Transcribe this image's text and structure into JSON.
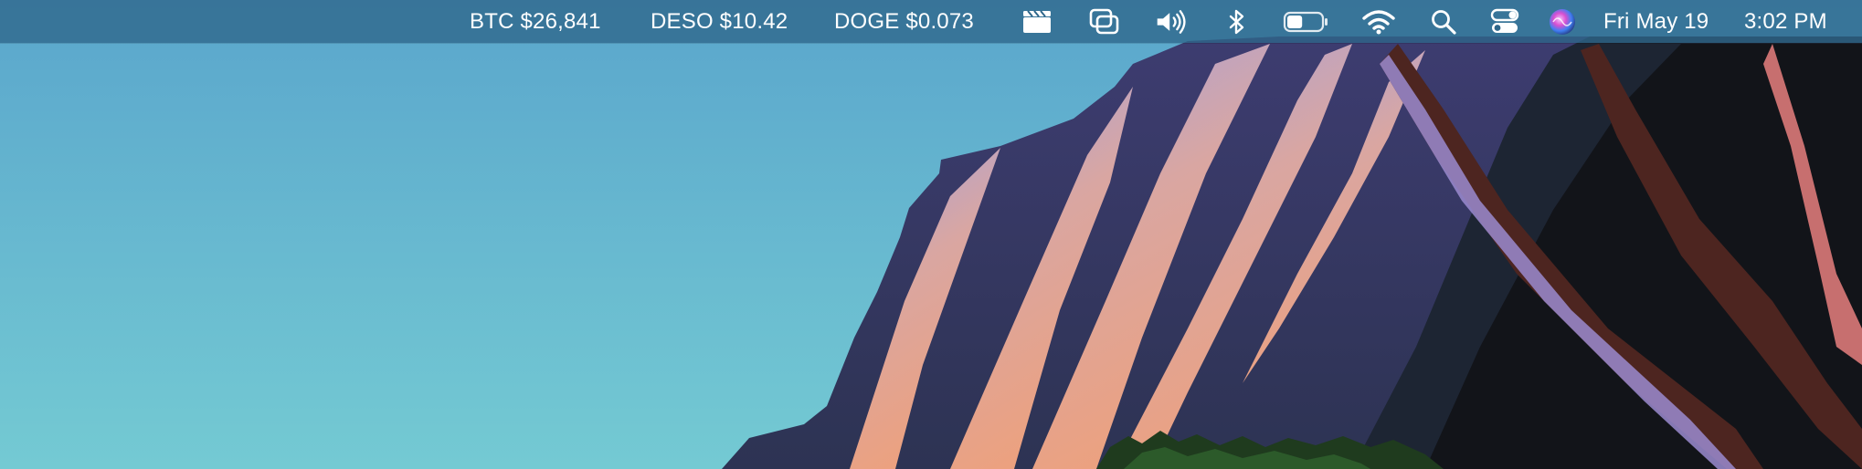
{
  "menubar": {
    "tickers": [
      {
        "label": "BTC $26,841"
      },
      {
        "label": "DESO $10.42"
      },
      {
        "label": "DOGE $0.073"
      }
    ],
    "status_icons": [
      "clapperboard-icon",
      "window-overlap-icon",
      "volume-icon",
      "bluetooth-icon",
      "battery-icon",
      "wifi-icon",
      "search-icon",
      "control-center-icon",
      "siri-icon"
    ],
    "battery_level": 0.45,
    "datetime": {
      "date": "Fri May 19",
      "time": "3:02 PM"
    }
  },
  "colors": {
    "menubar": "#2e668a",
    "sky_top": "#5aa6cc",
    "sky_bottom": "#74cad3"
  }
}
